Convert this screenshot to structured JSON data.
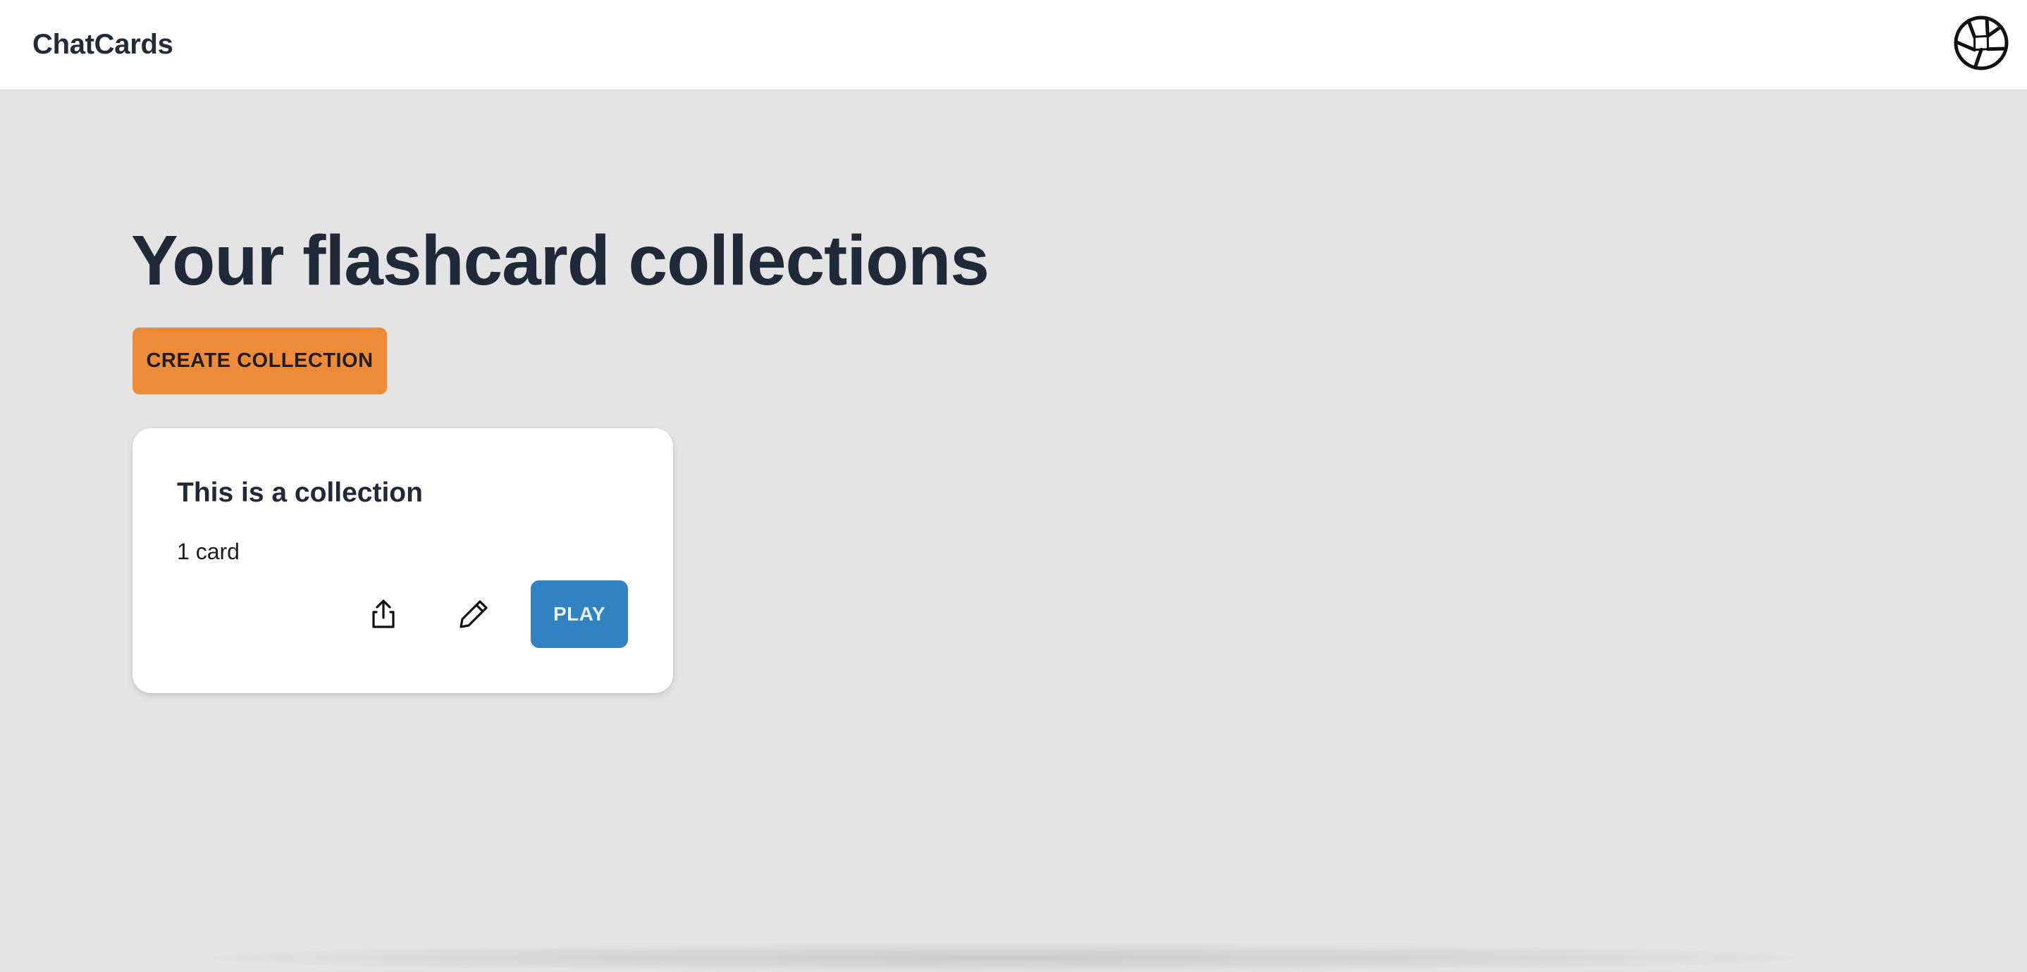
{
  "header": {
    "brand": "ChatCards",
    "avatar_icon": "aperture-icon"
  },
  "main": {
    "title": "Your flashcard collections",
    "create_button_label": "CREATE COLLECTION",
    "collections": [
      {
        "title": "This is a collection",
        "count": "1 card",
        "share_icon": "share-icon",
        "edit_icon": "pencil-icon",
        "play_label": "PLAY"
      }
    ]
  },
  "colors": {
    "background": "#e4e4e4",
    "header_background": "#ffffff",
    "create_button": "#ed8b38",
    "play_button": "#3182c3",
    "heading_text": "#202938"
  }
}
